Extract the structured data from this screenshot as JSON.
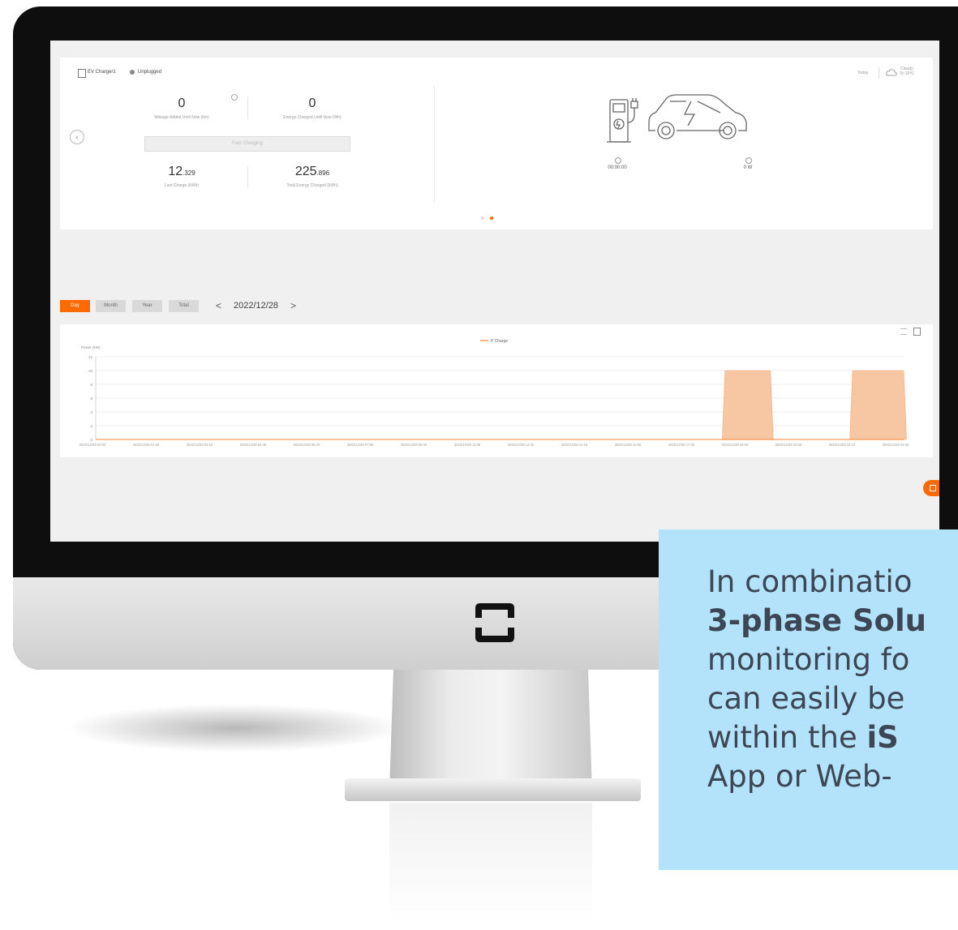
{
  "header": {
    "device_name": "EV Charger1",
    "device_status": "Unplugged",
    "date_label": "Today",
    "weather": "Cloudy",
    "temperature": "8~10℃"
  },
  "stats": {
    "mileage_value": "0",
    "mileage_label": "Mileage Added Until Now (km)",
    "energy_value": "0",
    "energy_label": "Energy Charged Until Now (Wh)",
    "mode_button": "Fast Charging",
    "last_charge_int": "12",
    "last_charge_dec": ".329",
    "last_charge_label": "Last Charge (kWh)",
    "total_int": "225",
    "total_dec": ".896",
    "total_label": "Total Energy Charged (kWh)"
  },
  "charger_panel": {
    "timer": "00:00:00",
    "power": "0 W"
  },
  "period_tabs": [
    "Day",
    "Month",
    "Year",
    "Total"
  ],
  "active_tab": "Day",
  "date_nav": {
    "date": "2022/12/28",
    "prev": "<",
    "next": ">"
  },
  "chart_data": {
    "type": "area",
    "legend": "P Charge",
    "ylabel": "Power (kW)",
    "ylim": [
      0,
      12
    ],
    "yticks": [
      "12",
      "10",
      "8",
      "6",
      "4",
      "2",
      "0"
    ],
    "xticks": [
      "2022/12/28 00:00",
      "2022/12/28 01:35",
      "2022/12/28 03:10",
      "2022/12/28 04:45",
      "2022/12/28 06:20",
      "2022/12/28 07:55",
      "2022/12/28 09:30",
      "2022/12/28 11:05",
      "2022/12/28 12:40",
      "2022/12/28 14:15",
      "2022/12/28 15:50",
      "2022/12/28 17:25",
      "2022/12/28 19:00",
      "2022/12/28 20:35",
      "2022/12/28 22:10",
      "2022/12/28 23:45"
    ],
    "series": [
      {
        "name": "P Charge",
        "color": "#f7c6a3",
        "points": [
          {
            "x": "00:00",
            "y": 0
          },
          {
            "x": "18:25",
            "y": 0
          },
          {
            "x": "18:30",
            "y": 10
          },
          {
            "x": "19:50",
            "y": 10
          },
          {
            "x": "19:55",
            "y": 0
          },
          {
            "x": "22:10",
            "y": 0
          },
          {
            "x": "22:15",
            "y": 10
          },
          {
            "x": "23:45",
            "y": 10
          },
          {
            "x": "23:50",
            "y": 0
          }
        ]
      }
    ]
  },
  "overlay": {
    "line1": "In combinatio",
    "line2": "3-phase Solu",
    "line3": "monitoring fo",
    "line4": "can easily be",
    "line5a": "within the ",
    "line5b": "iS",
    "line6": "App or Web-"
  },
  "colors": {
    "accent": "#ff6a00",
    "overlay_bg": "#b3e3fa"
  }
}
